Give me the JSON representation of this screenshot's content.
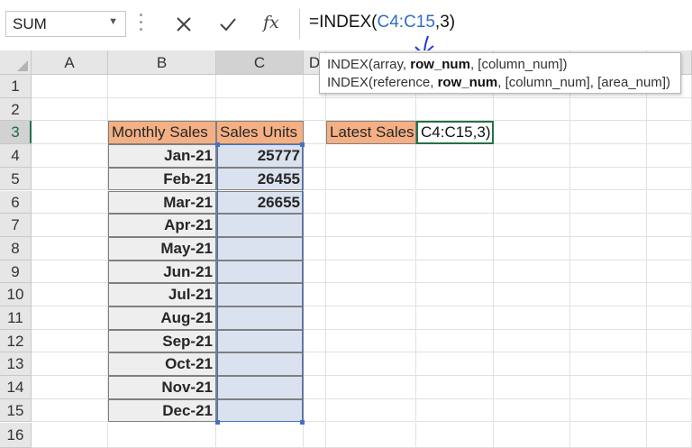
{
  "formula_bar": {
    "name_box": "SUM",
    "formula_prefix": "=INDEX(",
    "formula_ref": "C4:C15",
    "formula_suffix": ",3)",
    "cancel_icon": "cancel-x-icon",
    "enter_icon": "checkmark-icon",
    "fx_label": "fx"
  },
  "tooltip": {
    "line1": {
      "fn": "INDEX(",
      "a": "array, ",
      "b": "row_num",
      "c": ", [column_num])"
    },
    "line2": {
      "fn": "INDEX(",
      "a": "reference, ",
      "b": "row_num",
      "c": ", [column_num], [area_num])"
    }
  },
  "columns": [
    "A",
    "B",
    "C",
    "D"
  ],
  "rows": [
    "1",
    "2",
    "3",
    "4",
    "5",
    "6",
    "7",
    "8",
    "9",
    "10",
    "11",
    "12",
    "13",
    "14",
    "15",
    "16"
  ],
  "table": {
    "header_month": "Monthly Sales",
    "header_units": "Sales Units",
    "months": [
      "Jan-21",
      "Feb-21",
      "Mar-21",
      "Apr-21",
      "May-21",
      "Jun-21",
      "Jul-21",
      "Aug-21",
      "Sep-21",
      "Oct-21",
      "Nov-21",
      "Dec-21"
    ],
    "units": [
      "25777",
      "26455",
      "26655",
      "",
      "",
      "",
      "",
      "",
      "",
      "",
      "",
      ""
    ]
  },
  "latest": {
    "label": "Latest Sales",
    "edit_value": "C4:C15,3)"
  },
  "colors": {
    "header_fill": "#f4b084",
    "units_fill": "#dbe2ef",
    "date_fill": "#eeeeee",
    "ref_blue": "#2e6ec7",
    "active_green": "#217346"
  }
}
